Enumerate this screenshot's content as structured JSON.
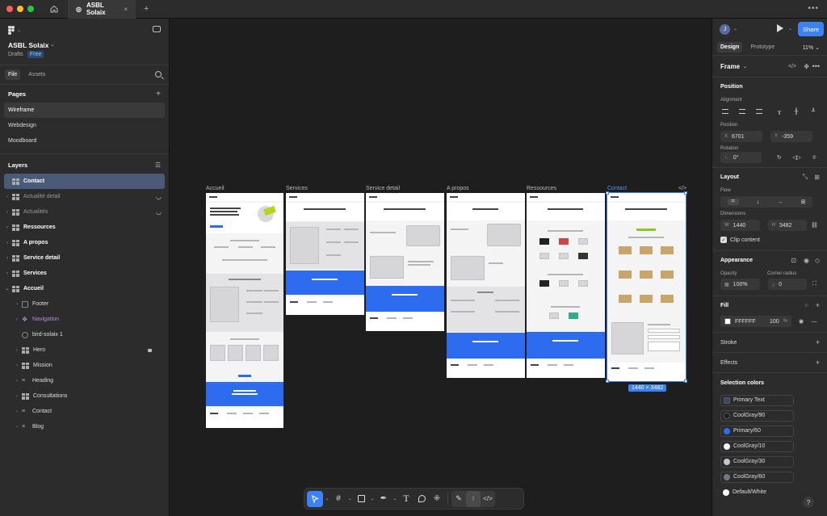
{
  "titlebar": {
    "tab_title": "ASBL Solaix",
    "close": "×",
    "plus": "+",
    "more": "•••"
  },
  "left_panel": {
    "project_name": "ASBL Solaix",
    "drafts": "Drafts",
    "plan_badge": "Free",
    "tabs": [
      "File",
      "Assets"
    ],
    "pages_title": "Pages",
    "pages": [
      "Wireframe",
      "Webdesign",
      "Moodboard"
    ],
    "layers_title": "Layers",
    "layers": [
      {
        "label": "Contact"
      },
      {
        "label": "Actualité detail"
      },
      {
        "label": "Actualités"
      },
      {
        "label": "Ressources"
      },
      {
        "label": "A propos"
      },
      {
        "label": "Service detail"
      },
      {
        "label": "Services"
      },
      {
        "label": "Accueil"
      }
    ],
    "children": [
      "Footer",
      "Navigation",
      "bird-solaix 1",
      "Hero",
      "Mission",
      "Heading",
      "Consultations",
      "Contact",
      "Blog"
    ]
  },
  "canvas": {
    "frames": [
      "Accueil",
      "Services",
      "Service detail",
      "A propos",
      "Ressources",
      "Contact"
    ],
    "size_tag": "1440 × 3482",
    "code_icon": "</>"
  },
  "right_panel": {
    "avatar": "J",
    "share": "Share",
    "tabs": [
      "Design",
      "Prototype"
    ],
    "zoom": "11%",
    "frame_title": "Frame",
    "position_title": "Position",
    "alignment_label": "Alignment",
    "position_label": "Position",
    "x_label": "X",
    "x_value": "6701",
    "y_label": "Y",
    "y_value": "-359",
    "rotation_label": "Rotation",
    "rotation_value": "0°",
    "layout_title": "Layout",
    "flow_label": "Flow",
    "dimensions_label": "Dimensions",
    "w_label": "W",
    "w_value": "1440",
    "h_label": "H",
    "h_value": "3482",
    "clip_content": "Clip content",
    "appearance_title": "Appearance",
    "opacity_label": "Opacity",
    "opacity_value": "100%",
    "corner_label": "Corner radius",
    "corner_value": "0",
    "fill_title": "Fill",
    "fill_hex": "FFFFFF",
    "fill_opacity": "100",
    "fill_pct": "%",
    "stroke_title": "Stroke",
    "effects_title": "Effects",
    "selection_colors_title": "Selection colors",
    "selection_colors": [
      {
        "name": "Primary Text",
        "color": "#3a4a66"
      },
      {
        "name": "CoolGray/90",
        "color": "#1a1d24"
      },
      {
        "name": "Primary/60",
        "color": "#2d6bef"
      },
      {
        "name": "CoolGray/10",
        "color": "#f2f4f8"
      },
      {
        "name": "CoolGray/30",
        "color": "#c1c7cd"
      },
      {
        "name": "CoolGray/60",
        "color": "#6f7780"
      },
      {
        "name": "Default/White",
        "color": "#ffffff"
      }
    ],
    "help": "?"
  },
  "colors": {
    "accent": "#3b82f6",
    "canvas_bg": "#1e1e1e",
    "panel_bg": "#2c2c2c",
    "frame_blue": "#2d6bef"
  }
}
